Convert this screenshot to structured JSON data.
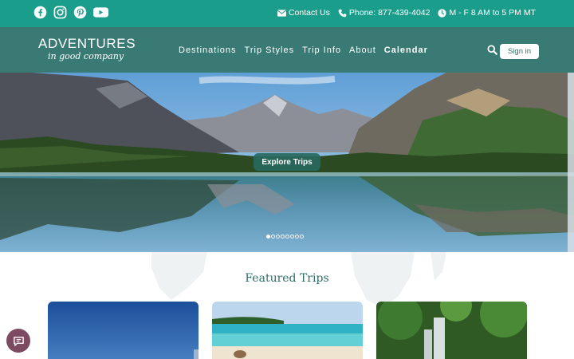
{
  "topbar": {
    "social": [
      {
        "icon": "facebook-icon"
      },
      {
        "icon": "instagram-icon"
      },
      {
        "icon": "pinterest-icon"
      },
      {
        "icon": "youtube-icon"
      }
    ],
    "contact_label": "Contact Us",
    "phone_label": "Phone: 877-439-4042",
    "hours_label": "M - F 8 AM to 5 PM MT"
  },
  "nav": {
    "logo_line1": "ADVENTURES",
    "logo_line2": "in good company",
    "items": [
      "Destinations",
      "Trip Styles",
      "Trip Info",
      "About",
      "Calendar"
    ],
    "signin_label": "Sign in"
  },
  "hero": {
    "cta_label": "Explore Trips",
    "slide_count": 8,
    "active_slide": 1
  },
  "featured": {
    "title": "Featured Trips"
  },
  "colors": {
    "topbar": "#1b9d8b",
    "navbar": "#3a7a74",
    "accent_dark": "#2e6e69",
    "chat": "#7c4b62"
  }
}
